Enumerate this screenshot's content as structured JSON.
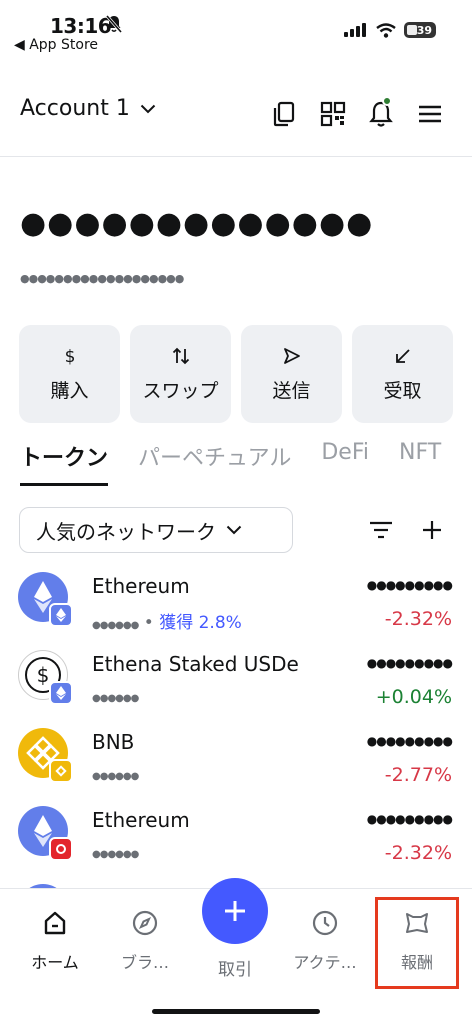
{
  "status": {
    "time": "13:16",
    "back": "◀ App Store",
    "battery": "39"
  },
  "header": {
    "account": "Account 1"
  },
  "balance": {
    "main": "●●●●●●●●●●●●●",
    "sub": "●●●●●●●●●●●●●●●●●●●"
  },
  "actions": [
    {
      "label": "購入",
      "icon": "dollar-icon"
    },
    {
      "label": "スワップ",
      "icon": "swap-arrows-icon"
    },
    {
      "label": "送信",
      "icon": "send-arrow-icon"
    },
    {
      "label": "受取",
      "icon": "receive-arrow-icon"
    }
  ],
  "tabs": [
    "トークン",
    "パーペチュアル",
    "DeFi",
    "NFT"
  ],
  "network": {
    "label": "人気のネットワーク"
  },
  "tokens": [
    {
      "name": "Ethereum",
      "hidden_balance": "●●●●●●",
      "earn": "獲得 2.8%",
      "value": "●●●●●●●●●",
      "change": "-2.32%",
      "color": "#627eea",
      "badge_color": "#627eea"
    },
    {
      "name": "Ethena Staked USDe",
      "hidden_balance": "●●●●●●",
      "value": "●●●●●●●●●",
      "change": "+0.04%",
      "color": "#ffffff",
      "badge_color": "#627eea"
    },
    {
      "name": "BNB",
      "hidden_balance": "●●●●●●",
      "value": "●●●●●●●●●",
      "change": "-2.77%",
      "color": "#f0b90b",
      "badge_color": "#f0b90b"
    },
    {
      "name": "Ethereum",
      "hidden_balance": "●●●●●●",
      "value": "●●●●●●●●●",
      "change": "-2.32%",
      "color": "#627eea",
      "badge_color": "#e3262c"
    }
  ],
  "nav": {
    "home": "ホーム",
    "browser": "ブラ…",
    "trade": "取引",
    "activity": "アクテ…",
    "rewards": "報酬"
  }
}
